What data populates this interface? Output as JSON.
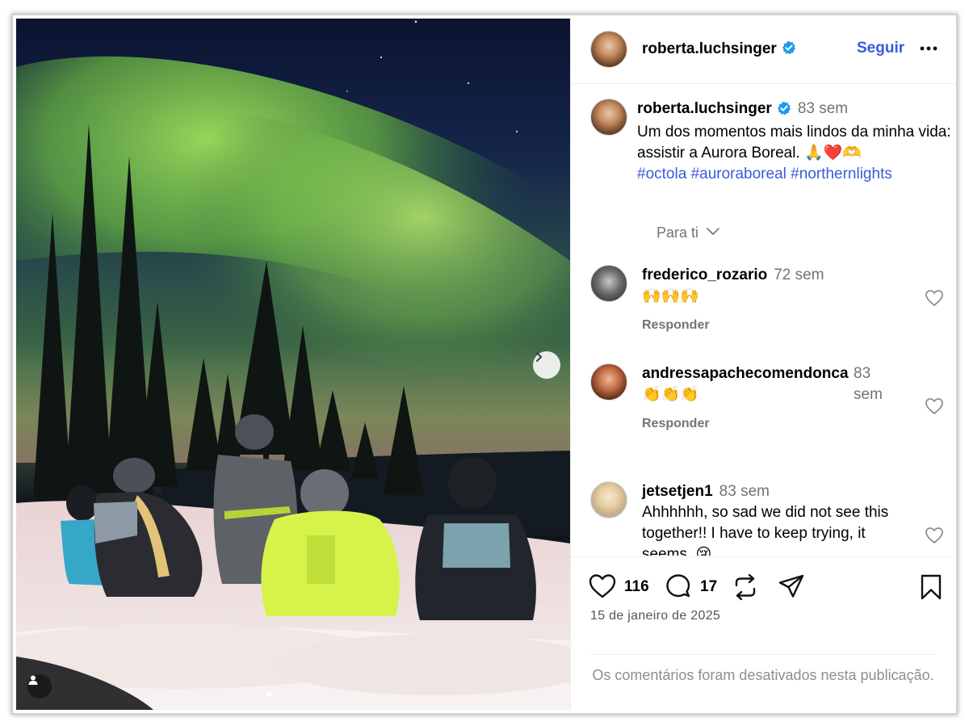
{
  "post": {
    "author": "roberta.luchsinger",
    "follow_label": "Seguir",
    "more_label": "•••"
  },
  "caption": {
    "username": "roberta.luchsinger",
    "time": "83 sem",
    "text": "Um dos momentos mais lindos da minha vida: assistir a Aurora Boreal. 🙏❤️🫶",
    "hashtags": [
      "#octola",
      "#auroraboreal",
      "#northernlights"
    ],
    "translate_label": "Para ti"
  },
  "comments": [
    {
      "username": "frederico_rozario",
      "time": "72 sem",
      "text": "🙌🙌🙌",
      "reply_label": "Responder"
    },
    {
      "username": "andressapachecomendonca",
      "time": "83 sem",
      "text": "👏👏👏",
      "reply_label": "Responder"
    },
    {
      "username": "jetsetjen1",
      "time": "83 sem",
      "text": "Ahhhhhh, so sad we did not see this together!! I have to keep trying, it seems. 😢"
    }
  ],
  "actions": {
    "likes": "116",
    "comments": "17",
    "date": "15 de janeiro de 2025"
  },
  "comments_disabled": "Os comentários foram desativados nesta publicação.",
  "colors": {
    "link_blue": "#3b5bdb",
    "verified_blue": "#1d9bf0",
    "muted_text": "#737373"
  }
}
